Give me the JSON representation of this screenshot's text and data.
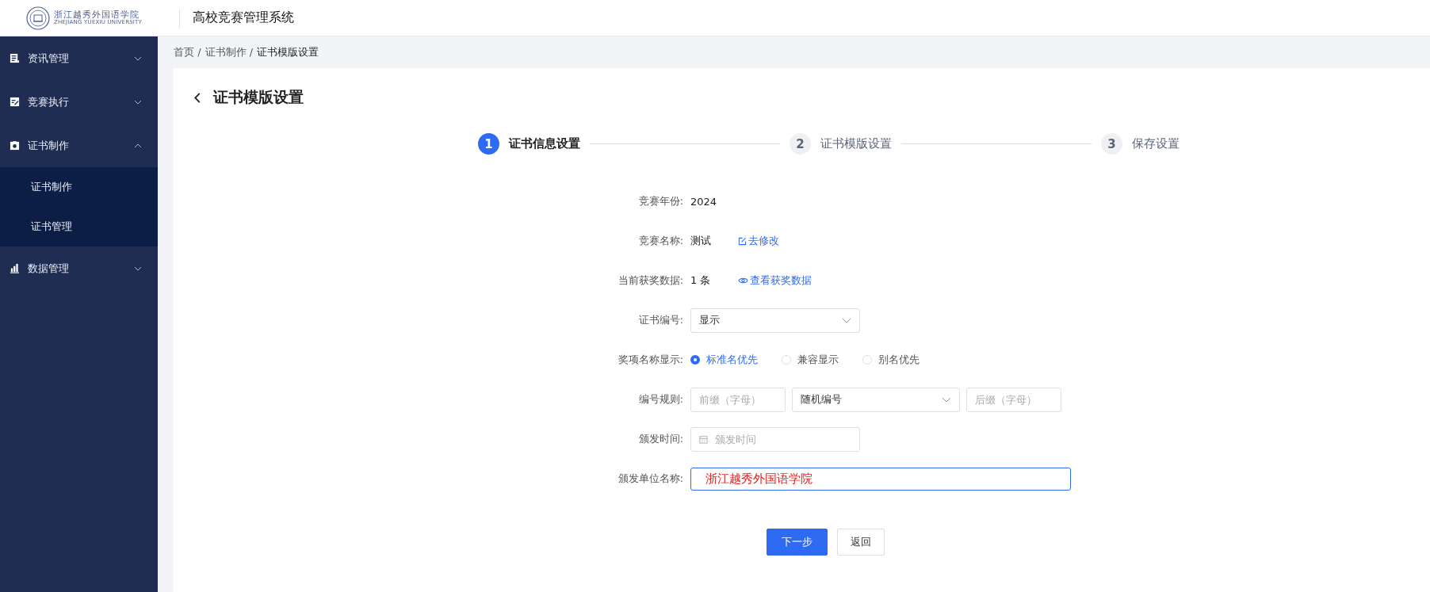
{
  "header": {
    "logo_name": "浙江越秀外国语学院",
    "logo_subtitle": "ZHEJIANG YUEXIU UNIVERSITY",
    "title": "高校竞赛管理系统"
  },
  "sidebar": {
    "items": [
      {
        "label": "资讯管理",
        "expanded": false
      },
      {
        "label": "竞赛执行",
        "expanded": false
      },
      {
        "label": "证书制作",
        "expanded": true,
        "children": [
          {
            "label": "证书制作",
            "selected": false
          },
          {
            "label": "证书管理",
            "selected": false
          }
        ]
      },
      {
        "label": "数据管理",
        "expanded": false
      }
    ]
  },
  "breadcrumb": [
    "首页 /",
    "证书制作 /",
    "证书模版设置"
  ],
  "page": {
    "title": "证书模版设置"
  },
  "steps": [
    {
      "number": "1",
      "label": "证书信息设置",
      "selected": true
    },
    {
      "number": "2",
      "label": "证书模版设置",
      "selected": false
    },
    {
      "number": "3",
      "label": "保存设置",
      "selected": false
    }
  ],
  "form": [
    {
      "kind": "text",
      "label": "竞赛年份:",
      "value": "2024"
    },
    {
      "kind": "edit_link",
      "label": "竞赛名称:",
      "value": "测试",
      "link": "去修改"
    },
    {
      "kind": "view_link",
      "label": "当前获奖数据:",
      "value": "1 条",
      "link": "查看获奖数据"
    },
    {
      "kind": "select",
      "label": "证书编号:",
      "value": "显示"
    },
    {
      "kind": "radio",
      "label": "奖项名称显示:",
      "options": [
        {
          "label": "标准名优先",
          "selected": true
        },
        {
          "label": "兼容显示",
          "selected": false
        },
        {
          "label": "别名优先",
          "selected": false
        }
      ]
    },
    {
      "kind": "rule",
      "label": "编号规则:",
      "prefix_placeholder": "前缀（字母）",
      "select_value": "随机编号",
      "suffix_placeholder": "后缀（字母）"
    },
    {
      "kind": "date",
      "label": "颁发时间:",
      "placeholder": "颁发时间"
    },
    {
      "kind": "input",
      "label": "颁发单位名称:",
      "value": "浙江越秀外国语学院"
    }
  ],
  "buttons": [
    {
      "label": "下一步",
      "kind": "primary"
    },
    {
      "label": "返回",
      "kind": "default"
    }
  ]
}
